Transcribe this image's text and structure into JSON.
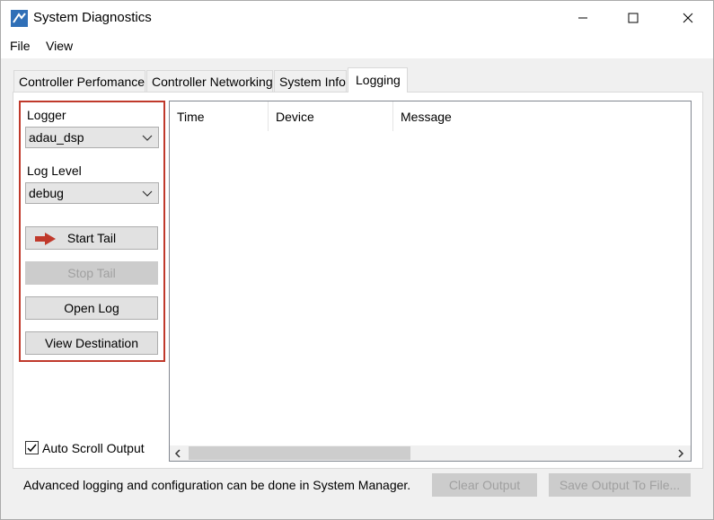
{
  "window": {
    "title": "System Diagnostics",
    "app_icon": "app-icon",
    "controls": {
      "minimize": "minimize-icon",
      "maximize": "maximize-icon",
      "close": "close-icon"
    }
  },
  "menu": {
    "file": "File",
    "view": "View"
  },
  "tabs": [
    {
      "label": "Controller Perfomance",
      "active": false
    },
    {
      "label": "Controller Networking",
      "active": false
    },
    {
      "label": "System Info",
      "active": false
    },
    {
      "label": "Logging",
      "active": true
    }
  ],
  "logging": {
    "logger_label": "Logger",
    "logger_value": "adau_dsp",
    "level_label": "Log Level",
    "level_value": "debug",
    "buttons": {
      "start_tail": "Start Tail",
      "stop_tail": "Stop Tail",
      "open_log": "Open Log",
      "view_destination": "View Destination"
    },
    "columns": [
      "Time",
      "Device",
      "Message"
    ],
    "auto_scroll_label": "Auto Scroll Output",
    "auto_scroll_checked": true
  },
  "footer": {
    "note": "Advanced logging and configuration can be done in System Manager.",
    "clear_output": "Clear Output",
    "save_output": "Save Output To File..."
  },
  "colors": {
    "highlight": "#c0392b",
    "arrow": "#c0392b",
    "disabled_text": "#a0a0a0"
  }
}
